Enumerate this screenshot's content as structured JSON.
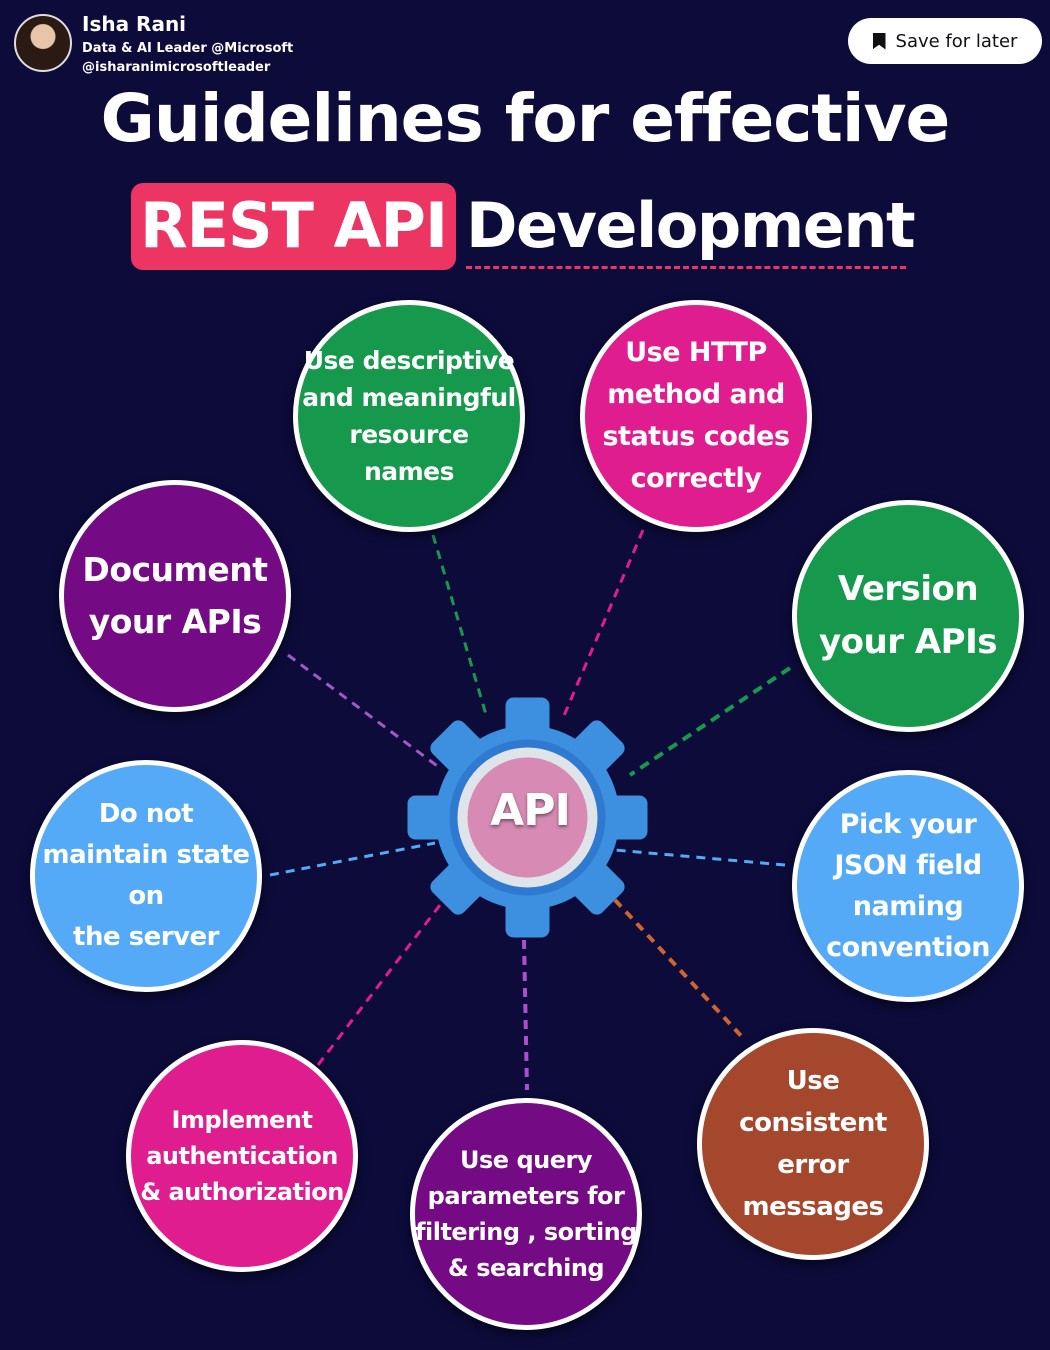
{
  "author": {
    "name": "Isha Rani",
    "role": "Data & AI Leader @Microsoft",
    "handle": "@isharanimicrosoftleader"
  },
  "save_button": {
    "label": "Save for later",
    "icon": "bookmark-icon"
  },
  "title": {
    "line1": "Guidelines for effective",
    "highlight": "REST API",
    "rest": "Development"
  },
  "center": {
    "label": "API"
  },
  "colors": {
    "background": "#0c0b3a",
    "accent": "#ec3562",
    "green": "#17994d",
    "magenta": "#e01d8e",
    "purple": "#740b84",
    "blue": "#55aaf7",
    "brown": "#a5472d",
    "gear": "#3d8fe0"
  },
  "guidelines": [
    {
      "text": "Use descriptive\nand meaningful\nresource\nnames",
      "color": "green"
    },
    {
      "text": "Use HTTP\nmethod and\nstatus codes\ncorrectly",
      "color": "magenta"
    },
    {
      "text": "Document\nyour APIs",
      "color": "purple"
    },
    {
      "text": "Version\nyour APIs",
      "color": "green"
    },
    {
      "text": "Do not\nmaintain state\non\nthe server",
      "color": "blue"
    },
    {
      "text": "Pick your\nJSON field\nnaming\nconvention",
      "color": "blue"
    },
    {
      "text": "Implement\nauthentication\n& authorization",
      "color": "magenta"
    },
    {
      "text": "Use query\nparameters for\nfiltering , sorting\n& searching",
      "color": "purple"
    },
    {
      "text": "Use\nconsistent error\nmessages",
      "color": "brown"
    }
  ]
}
